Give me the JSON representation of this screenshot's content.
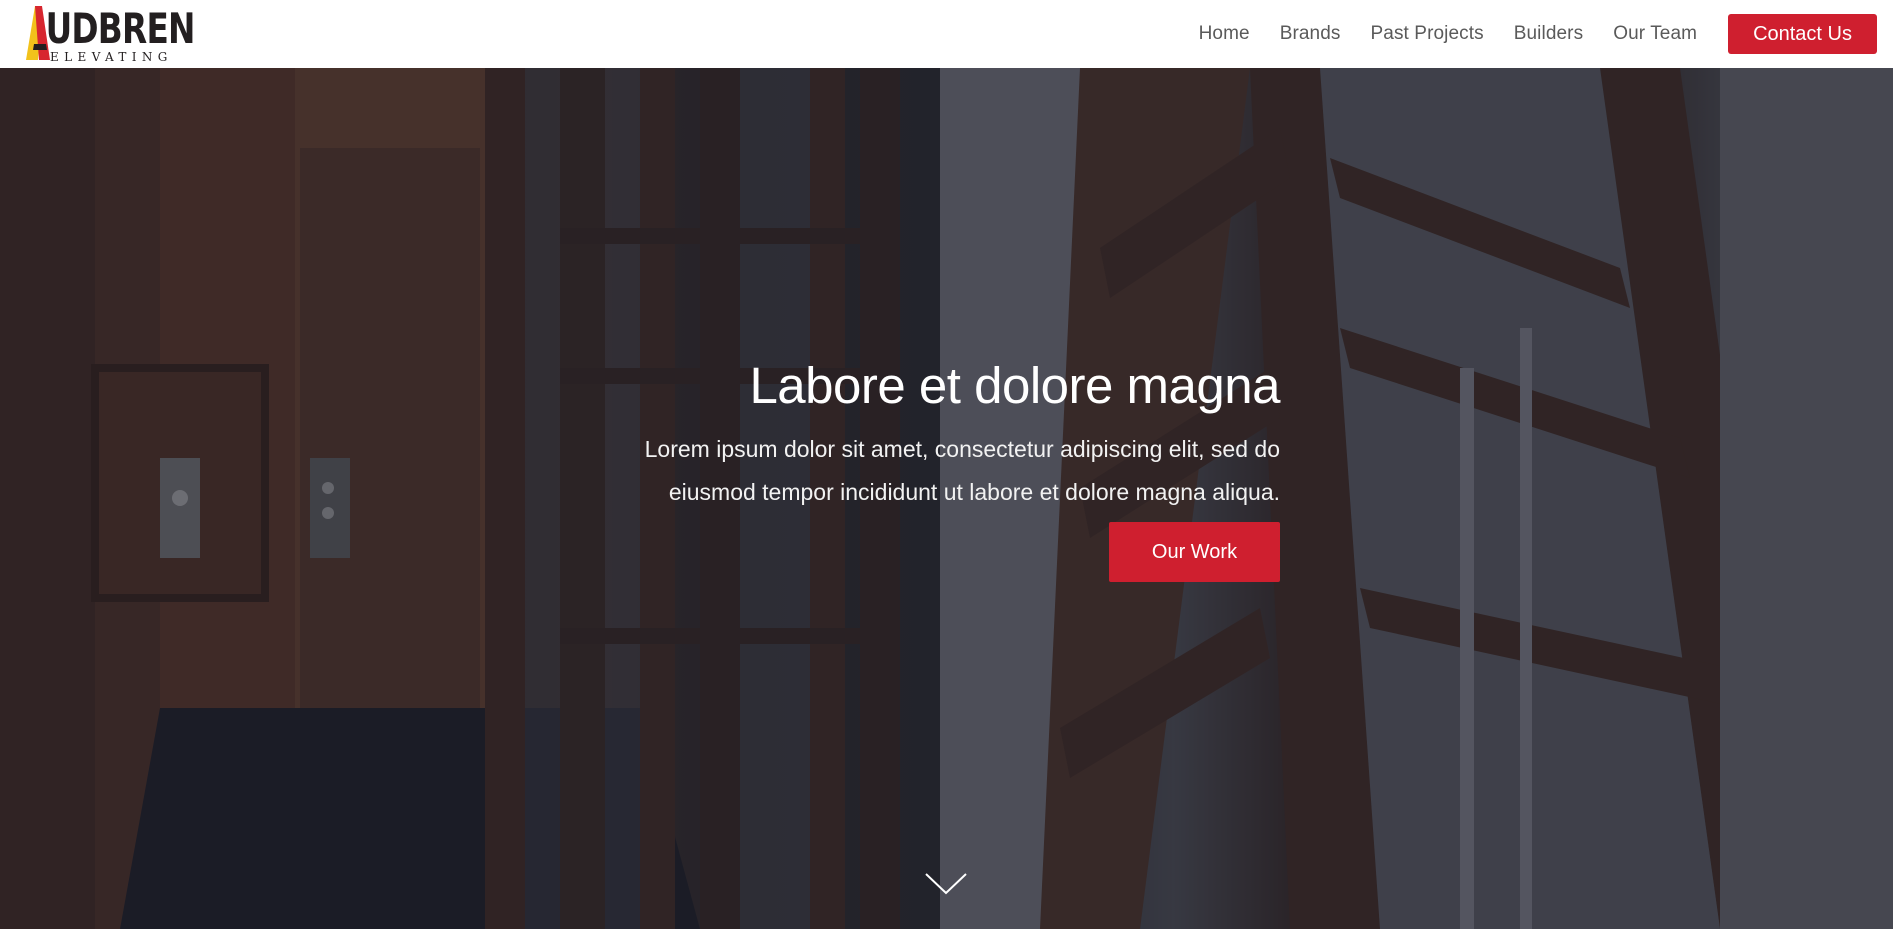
{
  "header": {
    "logo": {
      "wordmark": "AUDBREN",
      "subtitle": "ELEVATING"
    },
    "nav": [
      {
        "label": "Home"
      },
      {
        "label": "Brands"
      },
      {
        "label": "Past Projects"
      },
      {
        "label": "Builders"
      },
      {
        "label": "Our Team"
      }
    ],
    "cta_label": "Contact Us"
  },
  "hero": {
    "title": "Labore et dolore magna",
    "text_line1": "Lorem ipsum dolor sit amet, consectetur adipiscing elit, sed do",
    "text_line2": "eiusmod tempor incididunt ut labore et dolore magna aliqua.",
    "button_label": "Our Work",
    "scroll_icon": "chevron-down-icon"
  },
  "colors": {
    "accent": "#cf1f2f",
    "logo_yellow": "#f2c21b",
    "logo_red": "#d7262f",
    "header_bg": "#ffffff",
    "nav_text": "#5a5a5a"
  }
}
